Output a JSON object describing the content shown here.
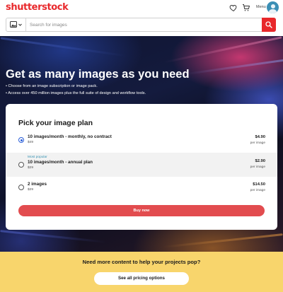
{
  "header": {
    "logo_text": "shutterstock",
    "brand_color": "#e8282b",
    "menu_label": "Menu",
    "icons": [
      "heart-icon",
      "cart-icon",
      "avatar-icon"
    ]
  },
  "search": {
    "placeholder": "Search for images",
    "type_icon": "image-icon",
    "button_icon": "search-icon"
  },
  "hero": {
    "title": "Get as many images as you need",
    "bullets": [
      "• Choose from an image subscription or image pack.",
      "• Access over 450 million images plus the full suite of design and workflow tools."
    ]
  },
  "plans": {
    "title": "Pick your image plan",
    "selected_index": 0,
    "options": [
      {
        "name": "10 images/month - monthly, no contract",
        "sub": "$49",
        "badge": "",
        "price": "$4.90",
        "unit": "per image",
        "selected": true
      },
      {
        "name": "10 images/month - annual plan",
        "sub": "$29",
        "badge": "Most popular",
        "price": "$2.90",
        "unit": "per image",
        "selected": false
      },
      {
        "name": "2 images",
        "sub": "$29",
        "badge": "",
        "price": "$14.50",
        "unit": "per image",
        "selected": false
      }
    ],
    "buy_label": "Buy now",
    "buy_color": "#e24c4f"
  },
  "promo": {
    "text": "Need more content to help your projects pop?",
    "button_label": "See all pricing options",
    "background_color": "#f8d56c"
  }
}
